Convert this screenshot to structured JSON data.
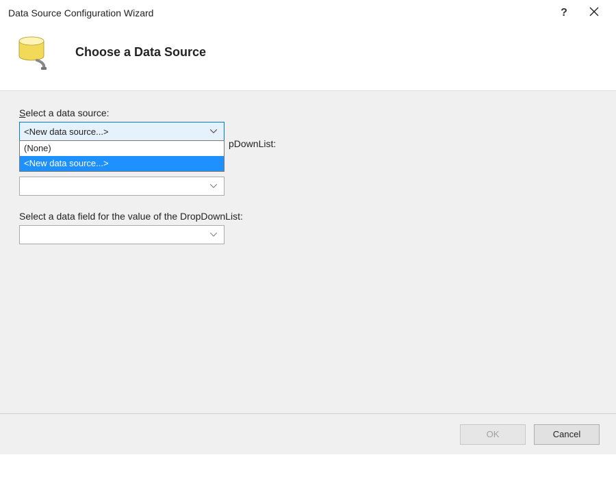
{
  "window": {
    "title": "Data Source Configuration Wizard",
    "help_symbol": "?",
    "close_symbol": "×"
  },
  "header": {
    "heading": "Choose a Data Source"
  },
  "fields": {
    "source": {
      "label_prefix": "S",
      "label_rest": "elect a data source:",
      "selected": "<New data source...>",
      "options": {
        "none": "(None)",
        "new": "<New data source...>"
      }
    },
    "display_field": {
      "label_visible_fragment": "pDownList:",
      "value": ""
    },
    "value_field": {
      "label": "Select a data field for the value of the DropDownList:",
      "value": ""
    }
  },
  "footer": {
    "ok": "OK",
    "cancel": "Cancel"
  }
}
